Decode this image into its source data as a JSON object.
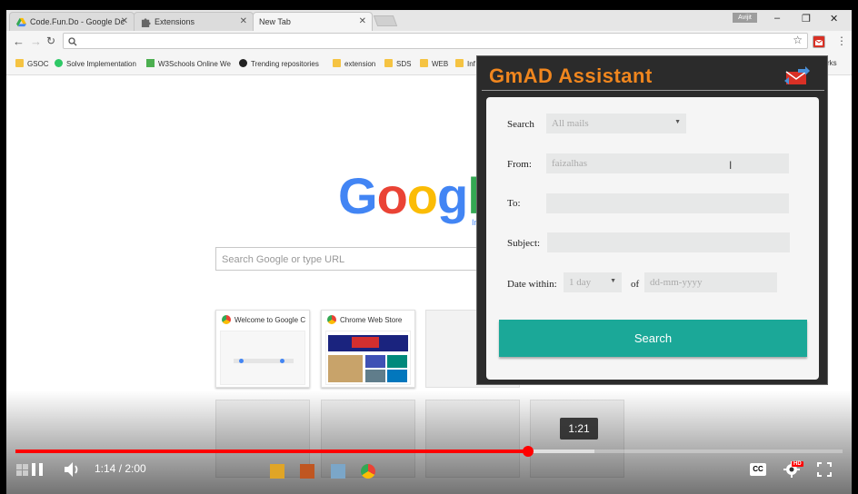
{
  "browser": {
    "tabs": [
      {
        "title": "Code.Fun.Do - Google Dc",
        "icon": "google-drive-icon"
      },
      {
        "title": "Extensions",
        "icon": "puzzle-icon"
      },
      {
        "title": "New Tab",
        "icon": ""
      }
    ],
    "user_badge": "Avijit",
    "window_controls": {
      "minimize": "–",
      "restore": "❐",
      "close": "✕"
    },
    "omnibox": {
      "value": "",
      "placeholder": ""
    },
    "bookmarks": [
      {
        "label": "GSOC",
        "icon": "folder-icon"
      },
      {
        "label": "Solve Implementation",
        "icon": "hackerrank-icon"
      },
      {
        "label": "W3Schools Online We",
        "icon": "w3schools-icon"
      },
      {
        "label": "Trending repositories",
        "icon": "github-icon"
      },
      {
        "label": "extension",
        "icon": "folder-icon"
      },
      {
        "label": "SDS",
        "icon": "folder-icon"
      },
      {
        "label": "WEB",
        "icon": "folder-icon"
      },
      {
        "label": "Inf",
        "icon": "folder-icon"
      },
      {
        "label": "rks",
        "icon": ""
      }
    ]
  },
  "newtab": {
    "logo_letters": [
      "G",
      "o",
      "o",
      "g",
      "l"
    ],
    "logo_colors": [
      "#4285f4",
      "#ea4335",
      "#fbbc05",
      "#4285f4",
      "#34a853"
    ],
    "logo_sub": "In",
    "search_placeholder": "Search Google or type URL",
    "tiles": [
      {
        "title": "Welcome to Google C"
      },
      {
        "title": "Chrome Web Store"
      }
    ]
  },
  "popup": {
    "title": "GmAD Assistant",
    "search_label": "Search",
    "search_value": "All mails",
    "from_label": "From:",
    "from_value": "faizalhas",
    "to_label": "To:",
    "to_value": "",
    "subject_label": "Subject:",
    "subject_value": "",
    "date_label": "Date within:",
    "date_value": "1 day",
    "of_label": "of",
    "date_placeholder": "dd-mm-yyyy",
    "button": "Search",
    "accent": "#1ba898",
    "title_color": "#f0861e"
  },
  "player": {
    "tooltip_time": "1:21",
    "time_display": "1:14 / 2:00",
    "played_fraction": 0.62,
    "buffered_fraction": 0.7,
    "hd_badge": "HD",
    "cc_label": "CC"
  }
}
